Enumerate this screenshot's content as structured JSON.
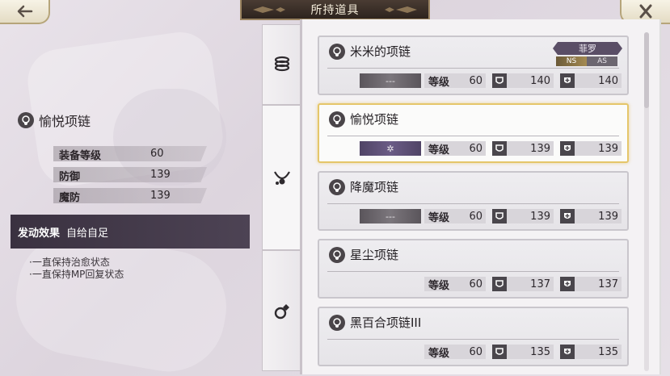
{
  "header": {
    "title": "所持道具"
  },
  "detail": {
    "name": "愉悦项链",
    "stats": [
      {
        "label": "装备等级",
        "value": "60"
      },
      {
        "label": "防御",
        "value": "139"
      },
      {
        "label": "魔防",
        "value": "139"
      }
    ],
    "effect_title": "发动效果",
    "effect_value": "自给自足",
    "effect_lines": [
      "·一直保持治愈状态",
      "·一直保持MP回复状态"
    ]
  },
  "list": {
    "level_label": "等级",
    "items": [
      {
        "name": "米米的项链",
        "skill": "---",
        "level": "60",
        "def": "140",
        "mdef": "140",
        "owner": "菲罗",
        "tag1": "NS",
        "tag2": "AS"
      },
      {
        "name": "愉悦项链",
        "skill": "✲",
        "level": "60",
        "def": "139",
        "mdef": "139"
      },
      {
        "name": "降魔项链",
        "skill": "---",
        "level": "60",
        "def": "139",
        "mdef": "139"
      },
      {
        "name": "星尘项链",
        "skill": "",
        "level": "60",
        "def": "137",
        "mdef": "137"
      },
      {
        "name": "黑百合项链III",
        "skill": "",
        "level": "60",
        "def": "135",
        "mdef": "135"
      }
    ]
  },
  "icons": {
    "back": "back-arrow-icon",
    "close": "close-icon",
    "tab1": "armor-icon",
    "tab2": "necklace-icon",
    "tab3": "ring-icon"
  },
  "colors": {
    "selected_border": "#e5c66a",
    "effect_bar": "#3a3140",
    "owner_badge": "#5a4e66"
  }
}
